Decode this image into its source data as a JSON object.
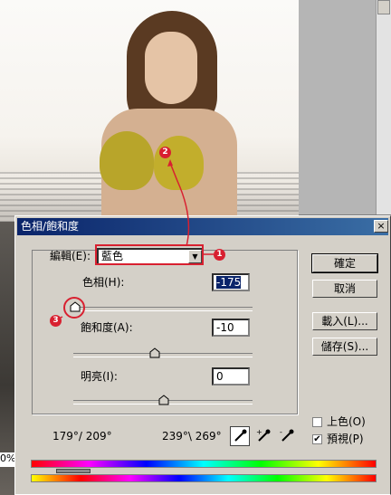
{
  "dialog": {
    "title": "色相/飽和度",
    "close_label": "×",
    "edit_label": "編輯(E):",
    "edit_value": "藍色",
    "hue_label": "色相(H):",
    "hue_value": "-175",
    "saturation_label": "飽和度(A):",
    "saturation_value": "-10",
    "lightness_label": "明亮(I):",
    "lightness_value": "0",
    "range_left": "179°/ 209°",
    "range_right": "239°\\ 269°",
    "buttons": {
      "ok": "確定",
      "cancel": "取消",
      "load": "載入(L)...",
      "save": "儲存(S)..."
    },
    "colorize_label": "上色(O)",
    "colorize_checked": false,
    "preview_label": "預視(P)",
    "preview_checked": true,
    "check_mark": "✔"
  },
  "callouts": [
    "1",
    "2",
    "3"
  ],
  "photo_zoom_fragment": "0%",
  "colors": {
    "title_bar": "#0a246a",
    "callout": "#d82030",
    "dialog_bg": "#d4d0c8"
  }
}
